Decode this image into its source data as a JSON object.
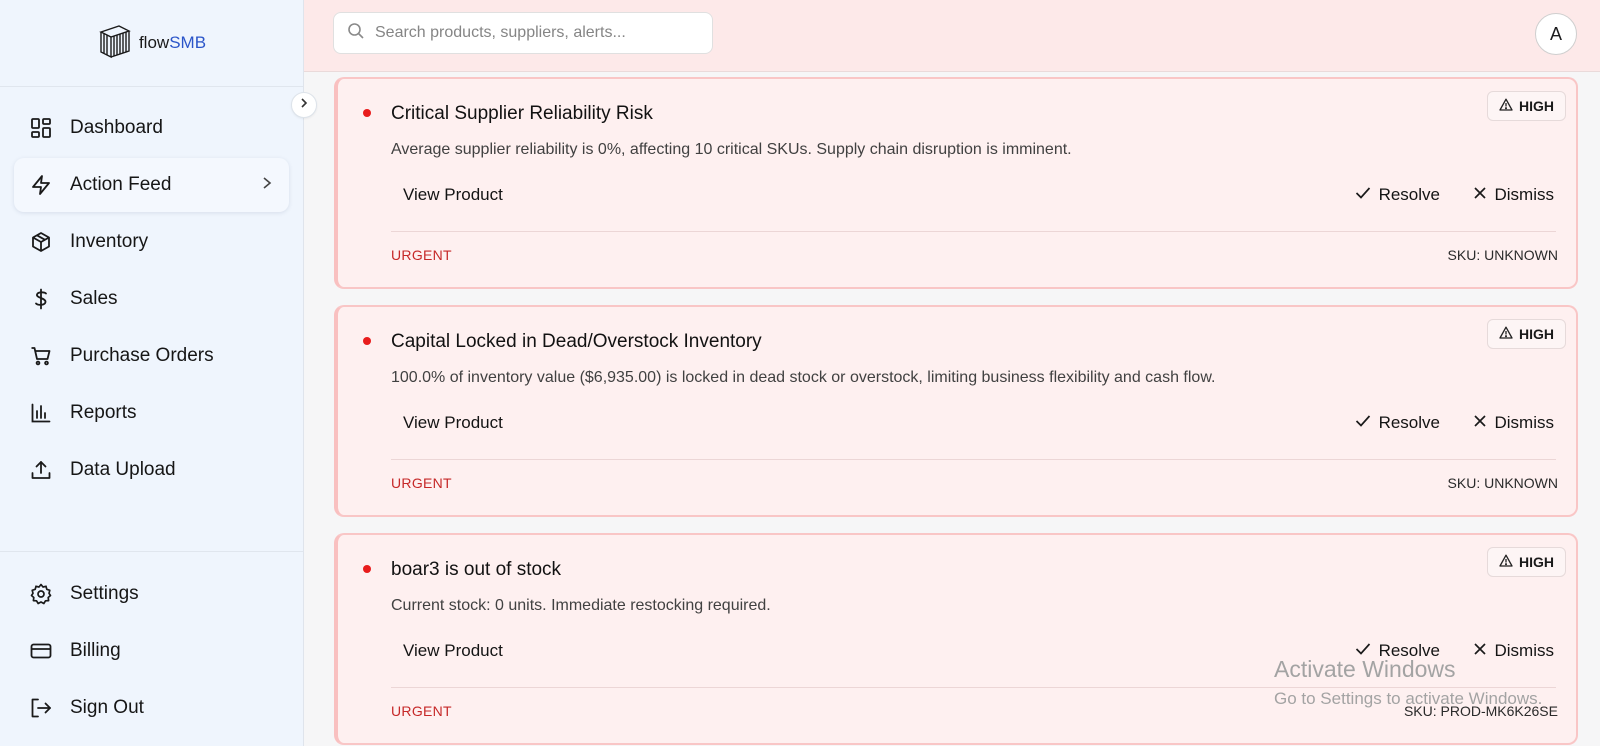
{
  "app": {
    "logo_prefix": "flow",
    "logo_suffix": "SMB"
  },
  "sidebar": {
    "items": [
      {
        "label": "Dashboard",
        "icon": "grid-icon"
      },
      {
        "label": "Action Feed",
        "icon": "lightning-icon",
        "active": true
      },
      {
        "label": "Inventory",
        "icon": "box-icon"
      },
      {
        "label": "Sales",
        "icon": "dollar-icon"
      },
      {
        "label": "Purchase Orders",
        "icon": "cart-icon"
      },
      {
        "label": "Reports",
        "icon": "bar-chart-icon"
      },
      {
        "label": "Data Upload",
        "icon": "upload-icon"
      }
    ],
    "bottom_items": [
      {
        "label": "Settings",
        "icon": "gear-icon"
      },
      {
        "label": "Billing",
        "icon": "credit-card-icon"
      },
      {
        "label": "Sign Out",
        "icon": "sign-out-icon"
      }
    ]
  },
  "header": {
    "search_placeholder": "Search products, suppliers, alerts...",
    "avatar_initial": "A"
  },
  "alerts": [
    {
      "title": "Critical Supplier Reliability Risk",
      "description": "Average supplier reliability is 0%, affecting 10 critical SKUs. Supply chain disruption is imminent.",
      "severity": "HIGH",
      "view_label": "View Product",
      "resolve_label": "Resolve",
      "dismiss_label": "Dismiss",
      "priority": "URGENT",
      "sku": "SKU: UNKNOWN"
    },
    {
      "title": "Capital Locked in Dead/Overstock Inventory",
      "description": "100.0% of inventory value ($6,935.00) is locked in dead stock or overstock, limiting business flexibility and cash flow.",
      "severity": "HIGH",
      "view_label": "View Product",
      "resolve_label": "Resolve",
      "dismiss_label": "Dismiss",
      "priority": "URGENT",
      "sku": "SKU: UNKNOWN"
    },
    {
      "title": "boar3 is out of stock",
      "description": "Current stock: 0 units. Immediate restocking required.",
      "severity": "HIGH",
      "view_label": "View Product",
      "resolve_label": "Resolve",
      "dismiss_label": "Dismiss",
      "priority": "URGENT",
      "sku": "SKU: PROD-MK6K26SE"
    }
  ],
  "watermark": {
    "line1": "Activate Windows",
    "line2": "Go to Settings to activate Windows."
  },
  "colors": {
    "accent": "#2b55c9",
    "urgent": "#c62828",
    "alert_dot": "#e81c1c",
    "card_bg": "#fef0f0",
    "sidebar_bg": "#eff5fd"
  }
}
